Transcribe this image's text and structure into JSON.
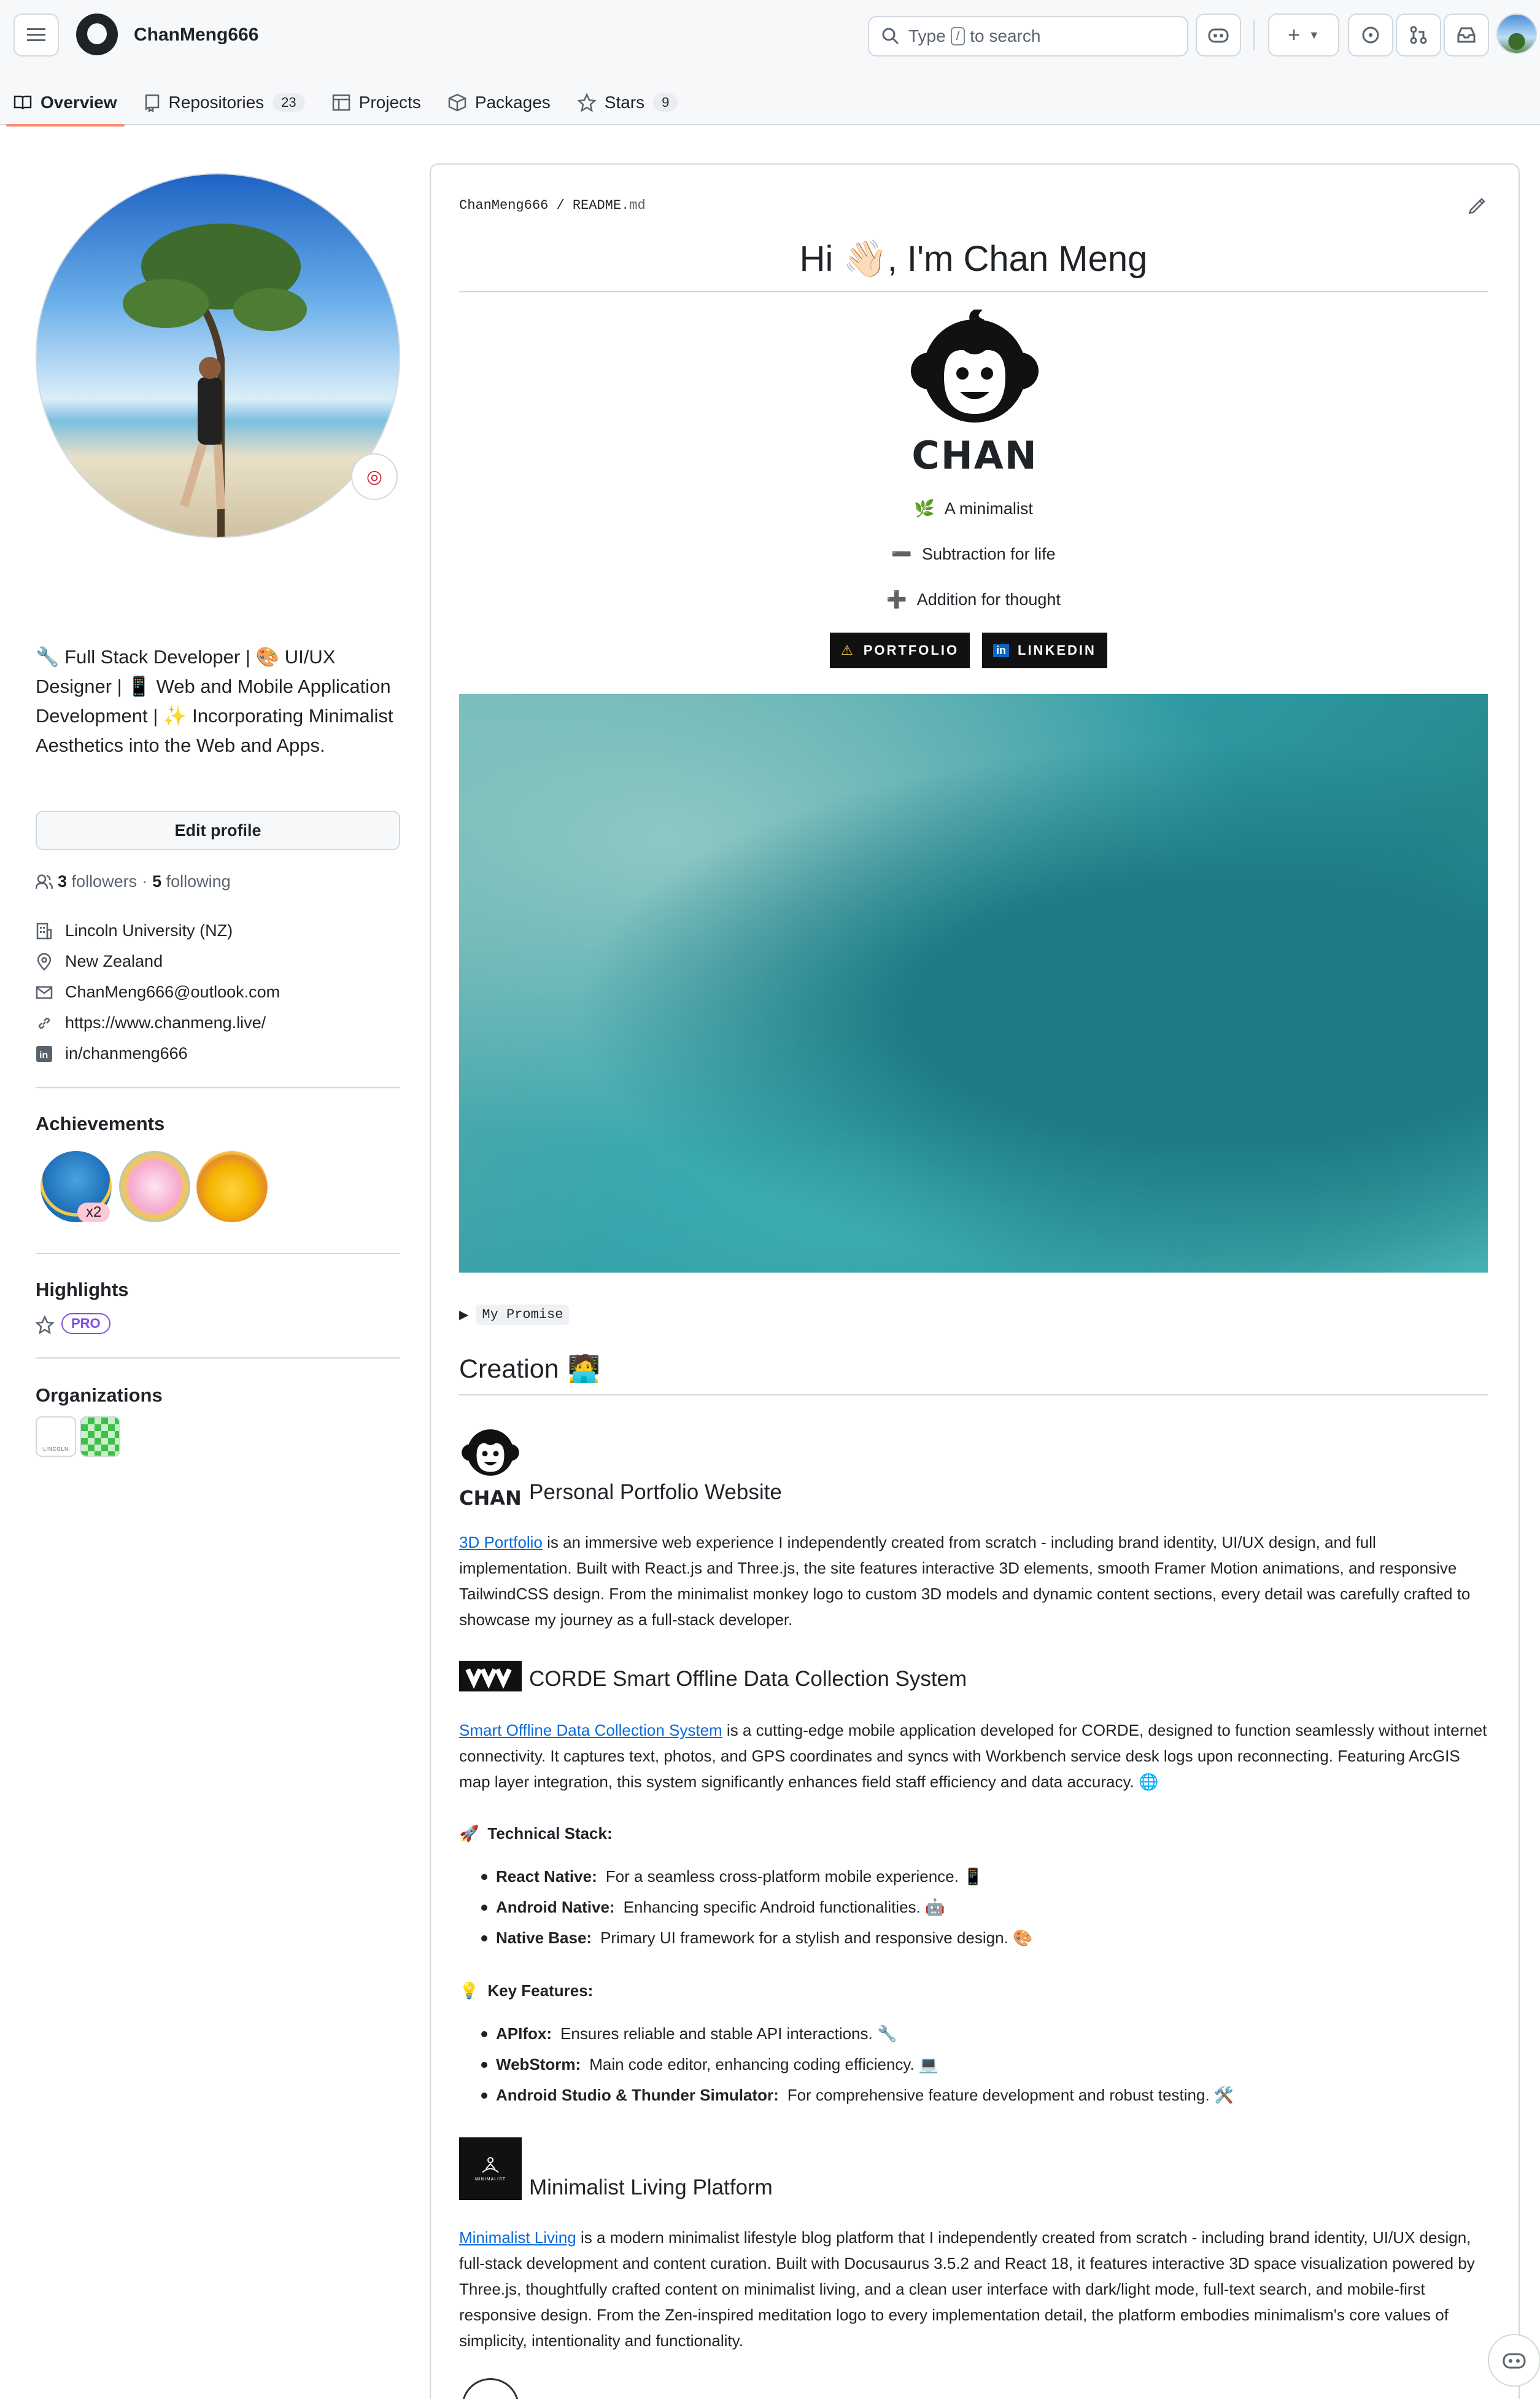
{
  "header": {
    "username": "ChanMeng666",
    "search_prefix": "Type",
    "search_key": "/",
    "search_suffix": "to search",
    "tabs": [
      {
        "label": "Overview",
        "count": ""
      },
      {
        "label": "Repositories",
        "count": "23"
      },
      {
        "label": "Projects",
        "count": ""
      },
      {
        "label": "Packages",
        "count": ""
      },
      {
        "label": "Stars",
        "count": "9"
      }
    ]
  },
  "sidebar": {
    "bio": "🔧 Full Stack Developer | 🎨 UI/UX Designer | 📱 Web and Mobile Application Development | ✨ Incorporating Minimalist Aesthetics into the Web and Apps.",
    "edit_profile": "Edit profile",
    "followers_count": "3",
    "followers_label": "followers",
    "following_count": "5",
    "following_label": "following",
    "separator": "·",
    "details": [
      {
        "icon": "organization-icon",
        "text": "Lincoln University (NZ)"
      },
      {
        "icon": "location-icon",
        "text": "New Zealand"
      },
      {
        "icon": "mail-icon",
        "text": "ChanMeng666@outlook.com"
      },
      {
        "icon": "link-icon",
        "text": "https://www.chanmeng.live/"
      },
      {
        "icon": "linkedin-icon",
        "text": "in/chanmeng666"
      }
    ],
    "achievements_title": "Achievements",
    "achievement_count": "x2",
    "highlights_title": "Highlights",
    "pro_badge": "PRO",
    "organizations_title": "Organizations",
    "org_lincoln_text": "LINCOLN"
  },
  "readme": {
    "path_user": "ChanMeng666",
    "path_sep": "/",
    "path_file": "README",
    "path_ext": ".md",
    "title": "Hi 👋🏻, I'm Chan Meng",
    "logo_text": "CHAN",
    "taglines": [
      {
        "icon": "🌿",
        "text": "A minimalist"
      },
      {
        "icon": "➖",
        "text": "Subtraction for life"
      },
      {
        "icon": "➕",
        "text": "Addition for thought"
      }
    ],
    "badges": [
      {
        "label": "PORTFOLIO",
        "icon": "⚠"
      },
      {
        "label": "LINKEDIN",
        "icon": "in"
      }
    ],
    "promise": "My Promise",
    "creation_title": "Creation",
    "creation_emoji": "🧑‍💻",
    "projects": [
      {
        "logo_text": "CHAN",
        "title": "Personal Portfolio Website",
        "link": "3D Portfolio",
        "body": " is an immersive web experience I independently created from scratch - including brand identity, UI/UX design, and full implementation. Built with React.js and Three.js, the site features interactive 3D elements, smooth Framer Motion animations, and responsive TailwindCSS design. From the minimalist monkey logo to custom 3D models and dynamic content sections, every detail was carefully crafted to showcase my journey as a full-stack developer."
      },
      {
        "title": "CORDE Smart Offline Data Collection System",
        "link": "Smart Offline Data Collection System",
        "body": " is a cutting-edge mobile application developed for CORDE, designed to function seamlessly without internet connectivity. It captures text, photos, and GPS coordinates and syncs with Workbench service desk logs upon reconnecting. Featuring ArcGIS map layer integration, this system significantly enhances field staff efficiency and data accuracy. 🌐"
      },
      {
        "logo_text": "MINIMALIST",
        "title": "Minimalist Living Platform",
        "link": "Minimalist Living",
        "body": " is a modern minimalist lifestyle blog platform that I independently created from scratch - including brand identity, UI/UX design, full-stack development and content curation. Built with Docusaurus 3.5.2 and React 18, it features interactive 3D space visualization powered by Three.js, thoughtfully crafted content on minimalist living, and a clean user interface with dark/light mode, full-text search, and mobile-first responsive design. From the Zen-inspired meditation logo to every implementation detail, the platform embodies minimalism's core values of simplicity, intentionality and functionality."
      }
    ],
    "tech_stack_title": "Technical Stack:",
    "tech_stack_icon": "🚀",
    "tech_stack": [
      {
        "name": "React Native:",
        "desc": "For a seamless cross-platform mobile experience. 📱"
      },
      {
        "name": "Android Native:",
        "desc": "Enhancing specific Android functionalities. 🤖"
      },
      {
        "name": "Native Base:",
        "desc": "Primary UI framework for a stylish and responsive design. 🎨"
      }
    ],
    "features_title": "Key Features:",
    "features_icon": "💡",
    "features": [
      {
        "name": "APIfox:",
        "desc": "Ensures reliable and stable API interactions. 🔧"
      },
      {
        "name": "WebStorm:",
        "desc": "Main code editor, enhancing coding efficiency. 💻"
      },
      {
        "name": "Android Studio & Thunder Simulator:",
        "desc": "For comprehensive feature development and robust testing. 🛠️"
      }
    ]
  },
  "colors": {
    "accent": "#fd8c73",
    "link": "#0969da",
    "pro": "#8250df"
  }
}
